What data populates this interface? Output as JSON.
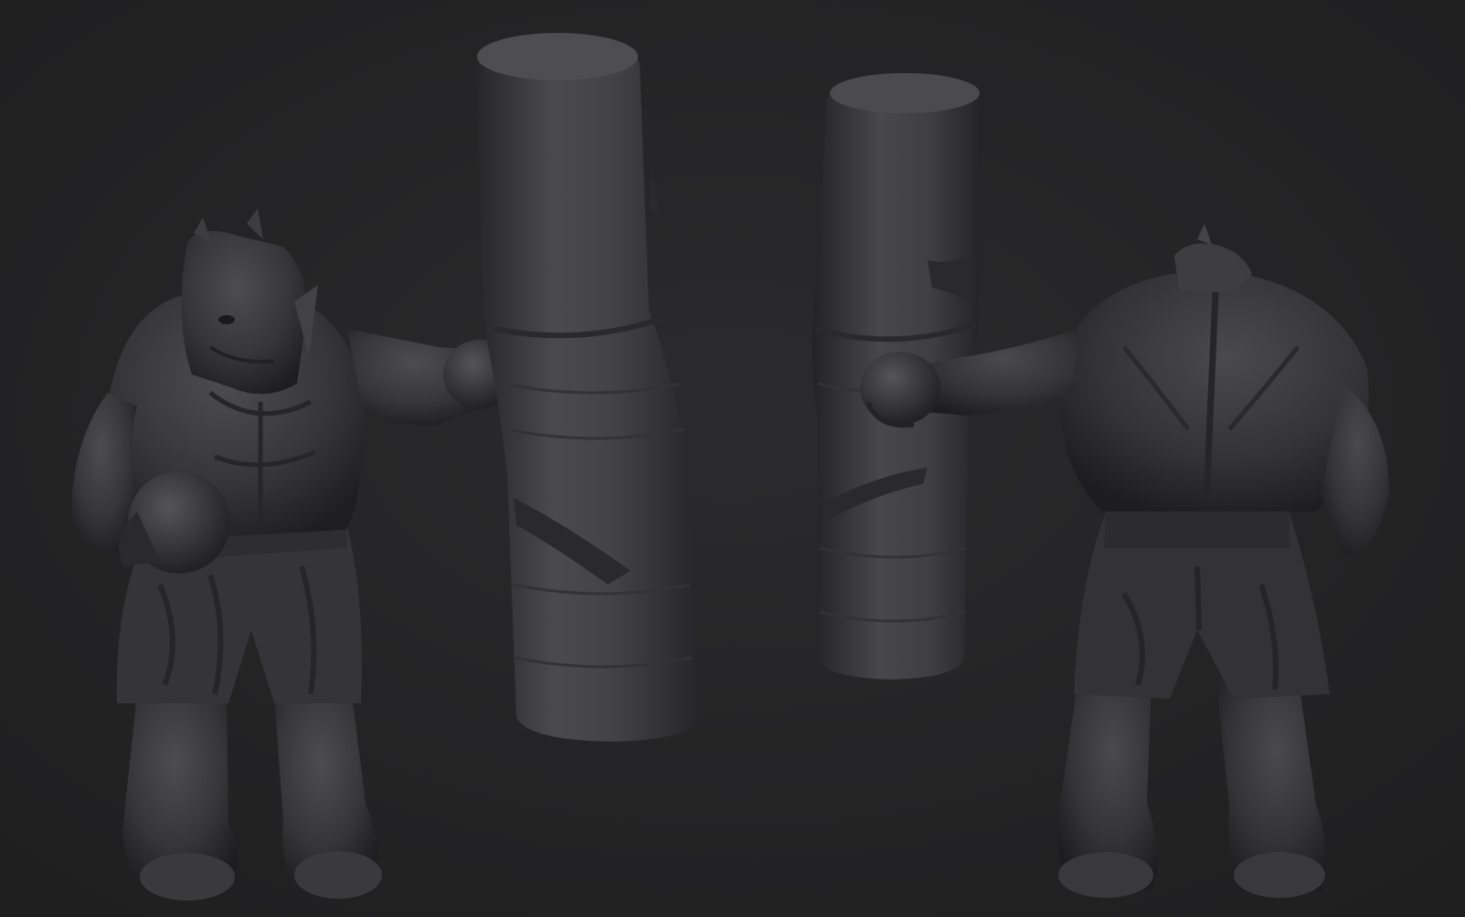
{
  "scene": {
    "background": "#242425",
    "clay_dark": "#1c1c1e",
    "clay_mid": "#3a3a3c",
    "clay_light": "#5a5a5d",
    "subjects": [
      {
        "name": "rhino-boxer-front-view",
        "icon": "rhino-boxer-icon"
      },
      {
        "name": "punching-bag-front-view",
        "icon": "punching-bag-icon"
      },
      {
        "name": "punching-bag-back-view",
        "icon": "punching-bag-icon"
      },
      {
        "name": "rhino-boxer-back-view",
        "icon": "rhino-boxer-icon"
      }
    ]
  }
}
